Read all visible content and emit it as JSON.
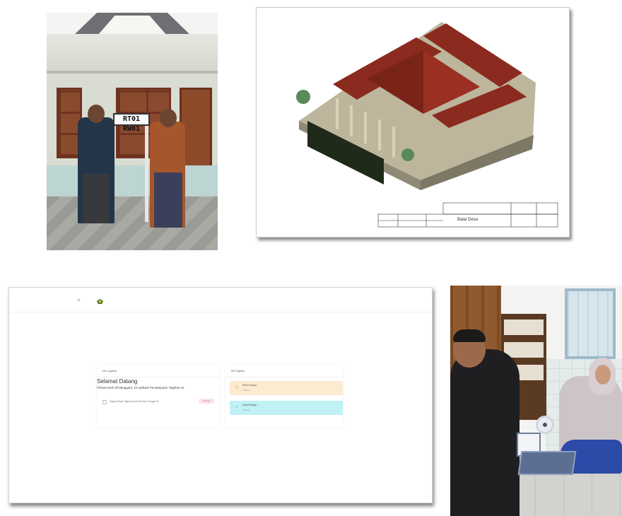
{
  "photo_house": {
    "sign_text": "RT01 RW01"
  },
  "cad_drawing": {
    "title_block_text": "Balai Desa"
  },
  "app_screenshot": {
    "user_card": {
      "header": "Info Layanan",
      "welcome_title": "Selamat Datang",
      "welcome_subtitle": "PDSat Desk (Pelanggan), Di Aplikasi Pembayaran Tagihan Air",
      "alert_text": "Segera Bayar Tagihan Anda Sebelum Tanggal 15",
      "alert_badge": "Penting"
    },
    "bill_card": {
      "header": "Info Tagihan",
      "unpaid_title": "Belum Bayar",
      "unpaid_sub": "0 Bulan",
      "paid_title": "Sudah Bayar",
      "paid_sub": "0 Bulan"
    },
    "colors": {
      "unpaid_bg": "#fdebcf",
      "paid_bg": "#bff1f5",
      "badge_text": "#e0576d"
    }
  }
}
